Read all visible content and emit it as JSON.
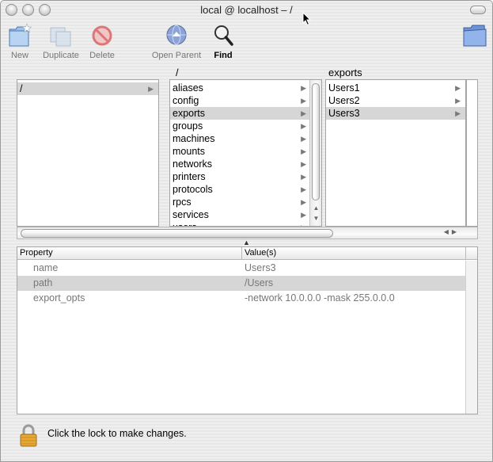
{
  "window": {
    "title": "local @ localhost – /"
  },
  "toolbar": {
    "new": "New",
    "duplicate": "Duplicate",
    "delete": "Delete",
    "open_parent": "Open Parent",
    "find": "Find"
  },
  "browser": {
    "column1": {
      "header": "",
      "items": [
        {
          "label": "/",
          "selected": true
        }
      ]
    },
    "column2": {
      "header": "/",
      "items": [
        {
          "label": "aliases"
        },
        {
          "label": "config"
        },
        {
          "label": "exports",
          "selected": true
        },
        {
          "label": "groups"
        },
        {
          "label": "machines"
        },
        {
          "label": "mounts"
        },
        {
          "label": "networks"
        },
        {
          "label": "printers"
        },
        {
          "label": "protocols"
        },
        {
          "label": "rpcs"
        },
        {
          "label": "services"
        },
        {
          "label": "users"
        }
      ]
    },
    "column3": {
      "header": "exports",
      "items": [
        {
          "label": "Users1"
        },
        {
          "label": "Users2"
        },
        {
          "label": "Users3",
          "selected": true
        }
      ]
    }
  },
  "properties": {
    "headers": {
      "property": "Property",
      "values": "Value(s)"
    },
    "rows": [
      {
        "property": "name",
        "value": "Users3"
      },
      {
        "property": "path",
        "value": "/Users",
        "selected": true
      },
      {
        "property": "export_opts",
        "value": "-network 10.0.0.0 -mask 255.0.0.0"
      }
    ]
  },
  "lock": {
    "message": "Click the lock to make changes."
  },
  "icons": {
    "new": "new-folder-icon",
    "duplicate": "duplicate-icon",
    "delete": "delete-icon",
    "open_parent": "globe-icon",
    "find": "magnifier-icon",
    "toolbar_toggle": "folder-icon",
    "lock": "lock-icon"
  },
  "colors": {
    "selection": "#d6d6d6",
    "disabled_text": "#777777"
  }
}
